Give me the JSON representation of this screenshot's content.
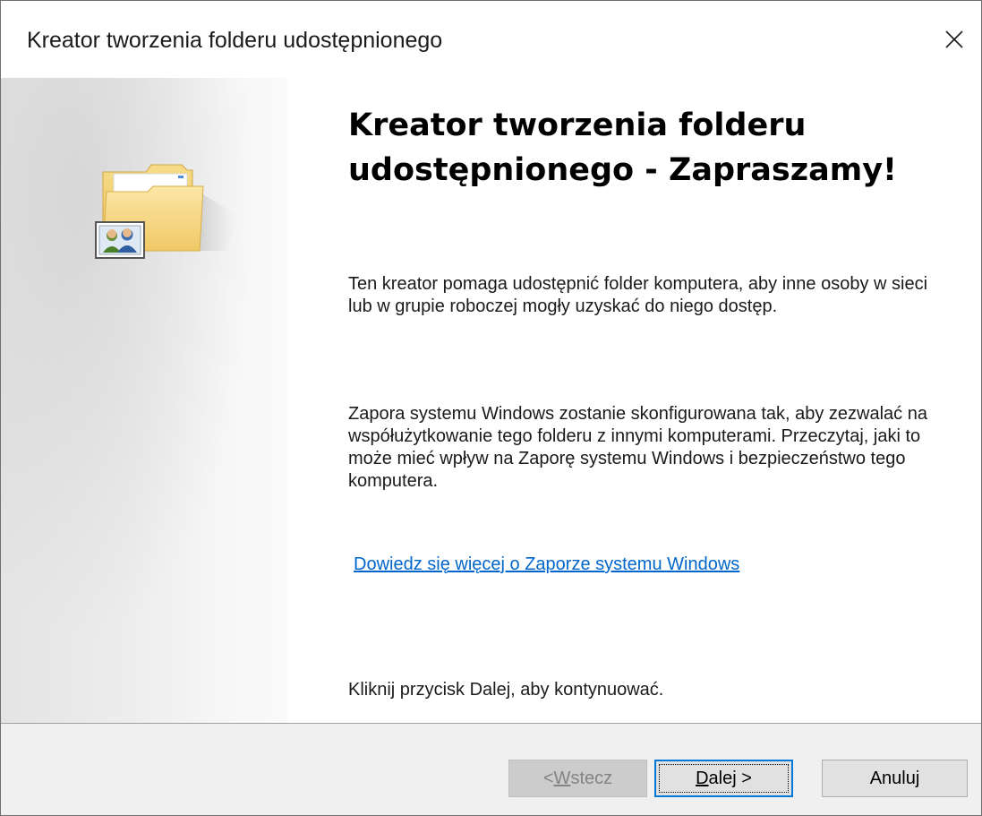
{
  "window": {
    "title": "Kreator tworzenia folderu udostępnionego"
  },
  "sidebar": {
    "icon": "shared-folder-icon"
  },
  "main": {
    "heading": "Kreator tworzenia folderu udostępnionego - Zapraszamy!",
    "paragraph1": "Ten kreator pomaga udostępnić folder komputera, aby inne osoby w sieci lub w grupie roboczej mogły uzyskać do niego dostęp.",
    "paragraph2": "Zapora systemu Windows zostanie skonfigurowana tak, aby zezwalać na współużytkowanie tego folderu z innymi komputerami. Przeczytaj, jaki to może mieć wpływ na Zaporę systemu Windows i bezpieczeństwo tego komputera.",
    "firewall_link": "Dowiedz się więcej o Zaporze systemu Windows",
    "continue_hint": "Kliknij przycisk Dalej, aby kontynuować."
  },
  "buttons": {
    "back": {
      "prefix": "< ",
      "accel": "W",
      "rest": "stecz",
      "enabled": false
    },
    "next": {
      "accel": "D",
      "rest": "alej >",
      "enabled": true
    },
    "cancel": {
      "label": "Anuluj",
      "enabled": true
    }
  },
  "colors": {
    "link": "#0066cc",
    "focus_border": "#0078d7",
    "footer_bg": "#f0f0f0",
    "disabled_text": "#838383"
  }
}
